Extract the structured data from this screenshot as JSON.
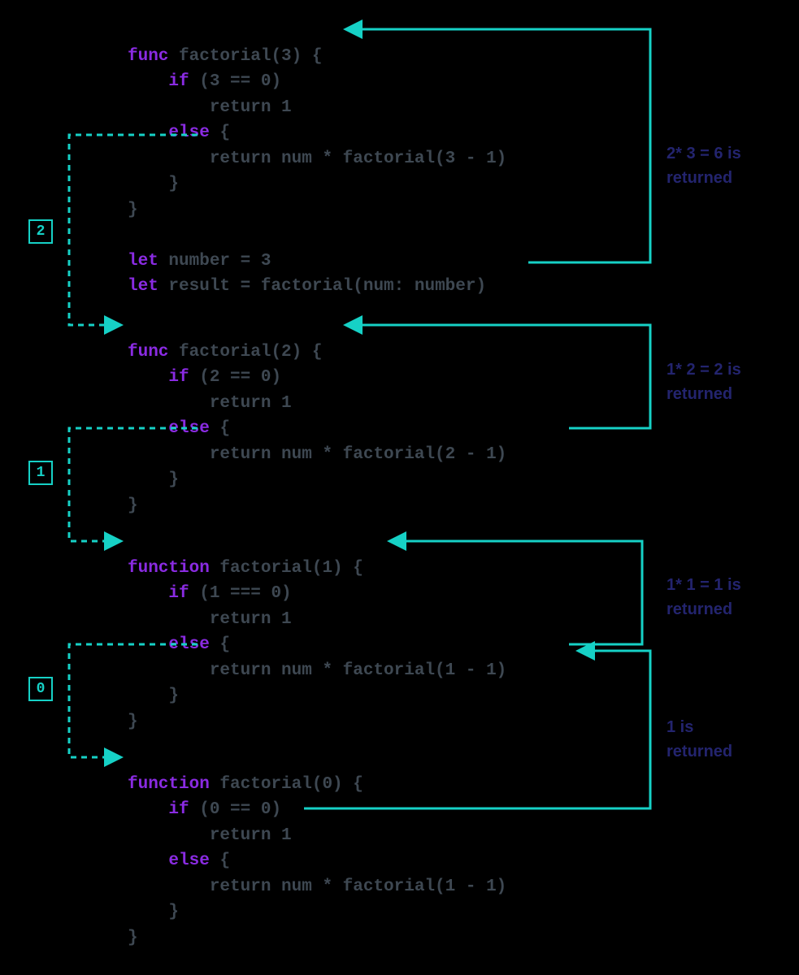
{
  "colors": {
    "arrow": "#16d1c6",
    "keyword": "#8a2be2",
    "text": "#3e4852",
    "annot": "#23246e"
  },
  "markers": {
    "m2": "2",
    "m1": "1",
    "m0": "0"
  },
  "annotations": {
    "a1_l1": "2* 3 = 6 is",
    "a1_l2": "returned",
    "a2_l1": "1* 2 = 2 is",
    "a2_l2": "returned",
    "a3_l1": "1* 1 = 1 is",
    "a3_l2": "returned",
    "a4_l1": "1 is",
    "a4_l2": "returned"
  },
  "block1": {
    "l1_kw": "func",
    "l1_rest": " factorial(3) {",
    "l2_pad": "    ",
    "l2_kw": "if",
    "l2_rest": " (3 == 0)",
    "l3": "        return 1",
    "l4_pad": "    ",
    "l4_kw": "else",
    "l4_rest": " {",
    "l5": "        return num * factorial(3 - 1)",
    "l6": "    }",
    "l7": "}",
    "l8": "",
    "l9_kw": "let",
    "l9_rest": " number = 3",
    "l10_kw": "let",
    "l10_rest": " result = factorial(num: number)"
  },
  "block2": {
    "l1_kw": "func",
    "l1_rest": " factorial(2) {",
    "l2_pad": "    ",
    "l2_kw": "if",
    "l2_rest": " (2 == 0)",
    "l3": "        return 1",
    "l4_pad": "    ",
    "l4_kw": "else",
    "l4_rest": " {",
    "l5": "        return num * factorial(2 - 1)",
    "l6": "    }",
    "l7": "}"
  },
  "block3": {
    "l1_kw": "function",
    "l1_rest": " factorial(1) {",
    "l2_pad": "    ",
    "l2_kw": "if",
    "l2_rest": " (1 === 0)",
    "l3": "        return 1",
    "l4_pad": "    ",
    "l4_kw": "else",
    "l4_rest": " {",
    "l5": "        return num * factorial(1 - 1)",
    "l6": "    }",
    "l7": "}"
  },
  "block4": {
    "l1_kw": "function",
    "l1_rest": " factorial(0) {",
    "l2_pad": "    ",
    "l2_kw": "if",
    "l2_rest": " (0 == 0)",
    "l3": "        return 1",
    "l4_pad": "    ",
    "l4_kw": "else",
    "l4_rest": " {",
    "l5": "        return num * factorial(1 - 1)",
    "l6": "    }",
    "l7": "}"
  }
}
